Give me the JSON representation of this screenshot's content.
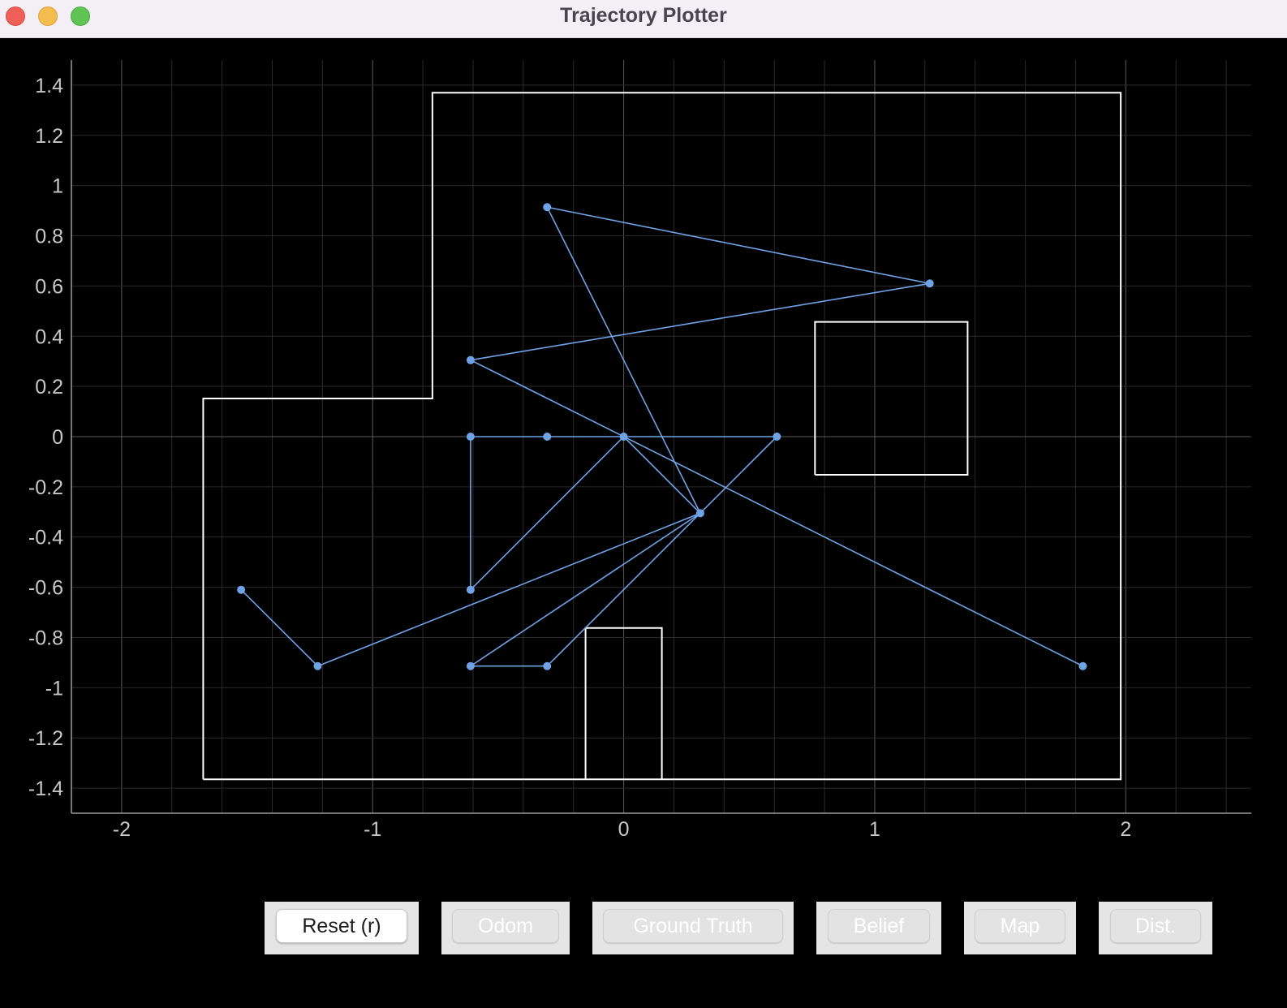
{
  "window": {
    "title": "Trajectory Plotter"
  },
  "colors": {
    "background": "#000000",
    "grid_major": "#5a5a5a",
    "grid_minor": "#2a2a2a",
    "axis": "#9a9a9a",
    "map": "#ffffff",
    "trajectory": "#6fa3e6",
    "tick_text": "#c8c8c8"
  },
  "buttons": [
    {
      "id": "reset",
      "label": "Reset (r)",
      "active": true
    },
    {
      "id": "odom",
      "label": "Odom",
      "active": false
    },
    {
      "id": "ground-truth",
      "label": "Ground Truth",
      "active": false
    },
    {
      "id": "belief",
      "label": "Belief",
      "active": false
    },
    {
      "id": "map",
      "label": "Map",
      "active": false
    },
    {
      "id": "dist",
      "label": "Dist.",
      "active": false
    }
  ],
  "chart_data": {
    "type": "line",
    "xlim": [
      -2.2,
      2.5
    ],
    "ylim": [
      -1.5,
      1.5
    ],
    "x_ticks": [
      -2,
      -1,
      0,
      1,
      2
    ],
    "x_tick_labels": [
      "-2",
      "-1",
      "0",
      "1",
      "2"
    ],
    "y_ticks": [
      1.4,
      1.2,
      1,
      0.8,
      0.6,
      0.4,
      0.2,
      0,
      -0.2,
      -0.4,
      -0.6,
      -0.8,
      -1,
      -1.2,
      -1.4
    ],
    "y_tick_labels": [
      "1.4",
      "1.2",
      "1",
      "0.8",
      "0.6",
      "0.4",
      "0.2",
      "0",
      "-0.2",
      "-0.4",
      "-0.6",
      "-0.8",
      "-1",
      "-1.2",
      "-1.4"
    ],
    "grid": true,
    "map_outline": [
      [
        -1.675,
        -1.365
      ],
      [
        -1.675,
        0.152
      ],
      [
        -0.762,
        0.152
      ],
      [
        -0.762,
        1.37
      ],
      [
        1.98,
        1.37
      ],
      [
        1.98,
        -1.365
      ],
      [
        -1.675,
        -1.365
      ]
    ],
    "obstacles": [
      [
        [
          0.762,
          -0.152
        ],
        [
          1.37,
          -0.152
        ],
        [
          1.37,
          0.457
        ],
        [
          0.762,
          0.457
        ],
        [
          0.762,
          -0.152
        ]
      ],
      [
        [
          -0.152,
          -1.365
        ],
        [
          -0.152,
          -0.762
        ],
        [
          0.152,
          -0.762
        ],
        [
          0.152,
          -1.365
        ]
      ]
    ],
    "trajectory_edges": [
      [
        [
          -0.305,
          0.914
        ],
        [
          1.219,
          0.61
        ]
      ],
      [
        [
          1.219,
          0.61
        ],
        [
          -0.61,
          0.305
        ]
      ],
      [
        [
          -0.305,
          0.914
        ],
        [
          0.305,
          -0.305
        ]
      ],
      [
        [
          -0.61,
          0.305
        ],
        [
          1.829,
          -0.914
        ]
      ],
      [
        [
          -0.61,
          0.0
        ],
        [
          0.61,
          0.0
        ]
      ],
      [
        [
          -0.61,
          0.0
        ],
        [
          -0.61,
          -0.61
        ]
      ],
      [
        [
          -0.61,
          -0.61
        ],
        [
          0.0,
          0.0
        ]
      ],
      [
        [
          0.0,
          0.0
        ],
        [
          0.305,
          -0.305
        ]
      ],
      [
        [
          0.61,
          0.0
        ],
        [
          -0.305,
          -0.914
        ]
      ],
      [
        [
          -0.305,
          -0.914
        ],
        [
          -0.61,
          -0.914
        ]
      ],
      [
        [
          -0.61,
          -0.914
        ],
        [
          0.305,
          -0.305
        ]
      ],
      [
        [
          0.305,
          -0.305
        ],
        [
          -1.219,
          -0.914
        ]
      ],
      [
        [
          -1.219,
          -0.914
        ],
        [
          -1.524,
          -0.61
        ]
      ]
    ],
    "trajectory_points": [
      [
        -0.305,
        0.914
      ],
      [
        1.219,
        0.61
      ],
      [
        -0.61,
        0.305
      ],
      [
        -0.61,
        0.0
      ],
      [
        -0.305,
        0.0
      ],
      [
        0.0,
        0.0
      ],
      [
        0.61,
        0.0
      ],
      [
        0.305,
        -0.305
      ],
      [
        -0.61,
        -0.61
      ],
      [
        -1.524,
        -0.61
      ],
      [
        -1.219,
        -0.914
      ],
      [
        -0.61,
        -0.914
      ],
      [
        -0.305,
        -0.914
      ],
      [
        1.829,
        -0.914
      ]
    ]
  }
}
